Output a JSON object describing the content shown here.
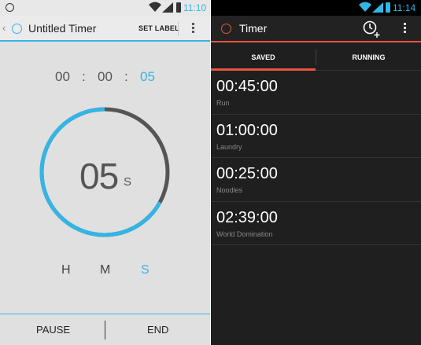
{
  "left_screen": {
    "status_time": "11:10",
    "title": "Untitled Timer",
    "set_label": "SET LABEL",
    "digits": {
      "hours": "00",
      "minutes": "00",
      "seconds": "05",
      "separator": ":"
    },
    "big_seconds": "05",
    "big_unit": "S",
    "unit_labels": {
      "h": "H",
      "m": "M",
      "s": "S"
    },
    "pause_label": "PAUSE",
    "end_label": "END",
    "progress_fraction": 0.67,
    "accent_color": "#33b5e5"
  },
  "right_screen": {
    "status_time": "11:14",
    "title": "Timer",
    "tabs": [
      {
        "label": "SAVED"
      },
      {
        "label": "RUNNING"
      }
    ],
    "timers": [
      {
        "duration": "00:45:00",
        "label": "Run"
      },
      {
        "duration": "01:00:00",
        "label": "Laundry"
      },
      {
        "duration": "00:25:00",
        "label": "Noodles"
      },
      {
        "duration": "02:39:00",
        "label": "World Domination"
      }
    ],
    "accent_color": "#e8553e"
  }
}
